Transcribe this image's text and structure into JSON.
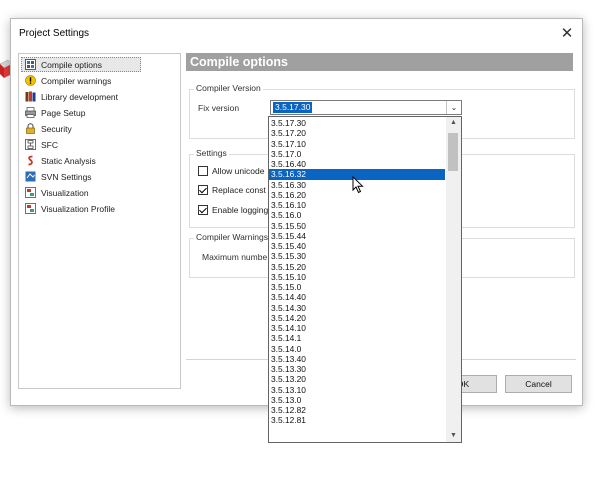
{
  "window": {
    "title": "Project Settings",
    "close_glyph": "✕"
  },
  "sidebar": {
    "items": [
      {
        "label": "Compile options",
        "icon": "compile-options-icon",
        "selected": true
      },
      {
        "label": "Compiler warnings",
        "icon": "warning-icon"
      },
      {
        "label": "Library development",
        "icon": "library-icon"
      },
      {
        "label": "Page Setup",
        "icon": "page-setup-icon"
      },
      {
        "label": "Security",
        "icon": "security-icon"
      },
      {
        "label": "SFC",
        "icon": "sfc-icon"
      },
      {
        "label": "Static Analysis",
        "icon": "static-analysis-icon"
      },
      {
        "label": "SVN Settings",
        "icon": "svn-icon"
      },
      {
        "label": "Visualization",
        "icon": "visualization-icon"
      },
      {
        "label": "Visualization Profile",
        "icon": "visualization-profile-icon"
      }
    ]
  },
  "main": {
    "header": "Compile options",
    "compiler_version": {
      "group_title": "Compiler Version",
      "fix_label": "Fix version",
      "selected": "3.5.17.30"
    },
    "settings": {
      "group_title": "Settings",
      "options": [
        {
          "label": "Allow unicode",
          "checked": false
        },
        {
          "label": "Replace const",
          "checked": true
        },
        {
          "label": "Enable logging",
          "checked": true
        }
      ]
    },
    "compiler_warnings": {
      "group_title": "Compiler Warnings",
      "max_label": "Maximum numbe"
    },
    "buttons": {
      "ok": "OK",
      "cancel": "Cancel"
    }
  },
  "dropdown": {
    "highlighted": "3.5.16.32",
    "items": [
      "3.5.17.30",
      "3.5.17.20",
      "3.5.17.10",
      "3.5.17.0",
      "3.5.16.40",
      "3.5.16.32",
      "3.5.16.30",
      "3.5.16.20",
      "3.5.16.10",
      "3.5.16.0",
      "3.5.15.50",
      "3.5.15.44",
      "3.5.15.40",
      "3.5.15.30",
      "3.5.15.20",
      "3.5.15.10",
      "3.5.15.0",
      "3.5.14.40",
      "3.5.14.30",
      "3.5.14.20",
      "3.5.14.10",
      "3.5.14.1",
      "3.5.14.0",
      "3.5.13.40",
      "3.5.13.30",
      "3.5.13.20",
      "3.5.13.10",
      "3.5.13.0",
      "3.5.12.82",
      "3.5.12.81"
    ]
  }
}
